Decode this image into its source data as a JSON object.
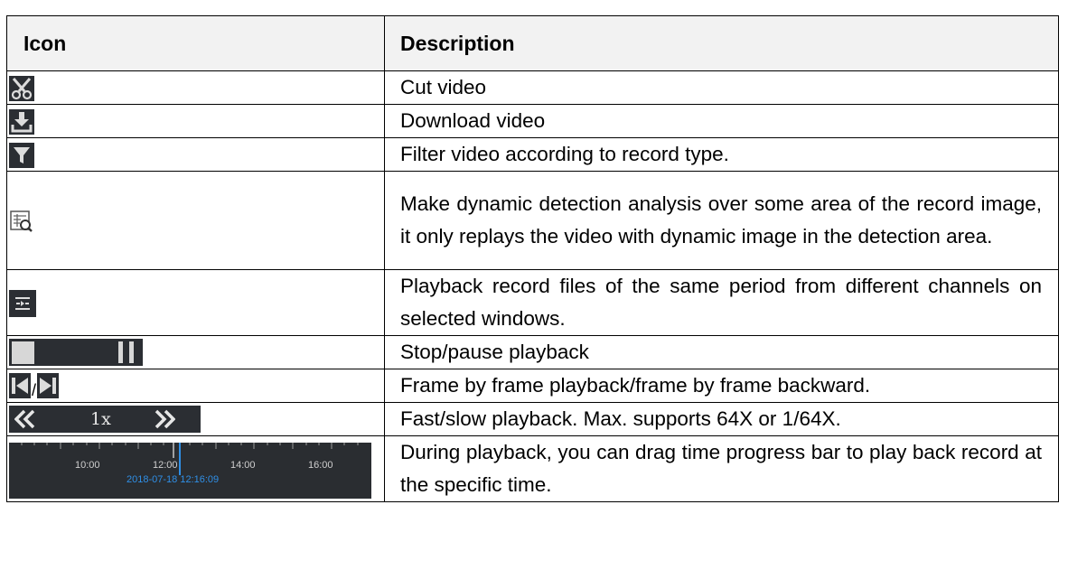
{
  "table": {
    "headers": {
      "icon": "Icon",
      "description": "Description"
    },
    "rows": [
      {
        "icon": "cut-icon",
        "description": "Cut video"
      },
      {
        "icon": "download-icon",
        "description": "Download video"
      },
      {
        "icon": "filter-icon",
        "description": "Filter video according to record type."
      },
      {
        "icon": "smart-search-icon",
        "description": "Make dynamic detection analysis over some area of the record image, it only replays the video with dynamic image in the detection area."
      },
      {
        "icon": "sync-playback-icon",
        "description": "Playback record files of the same period from different channels on selected windows."
      },
      {
        "icon": "stop-pause-icon",
        "description": "Stop/pause playback"
      },
      {
        "icon": "frame-step-icon",
        "description": "Frame by frame playback/frame by frame backward."
      },
      {
        "icon": "speed-control-icon",
        "description": "Fast/slow playback. Max. supports 64X or 1/64X."
      },
      {
        "icon": "timeline-bar-icon",
        "description": "During playback, you can drag time progress bar to play back record at the specific time."
      }
    ]
  },
  "frame_separator": "/",
  "speed": {
    "value": "1x"
  },
  "timeline": {
    "ticks": [
      "10:00",
      "12:00",
      "14:00",
      "16:00"
    ],
    "current": "2018-07-18 12:16:09"
  },
  "colors": {
    "header_bg": "#f2f2f2",
    "icon_bg": "#2b2e33",
    "icon_fg": "#d7d7d7",
    "accent_blue": "#2f8fe6",
    "border": "#000000"
  }
}
